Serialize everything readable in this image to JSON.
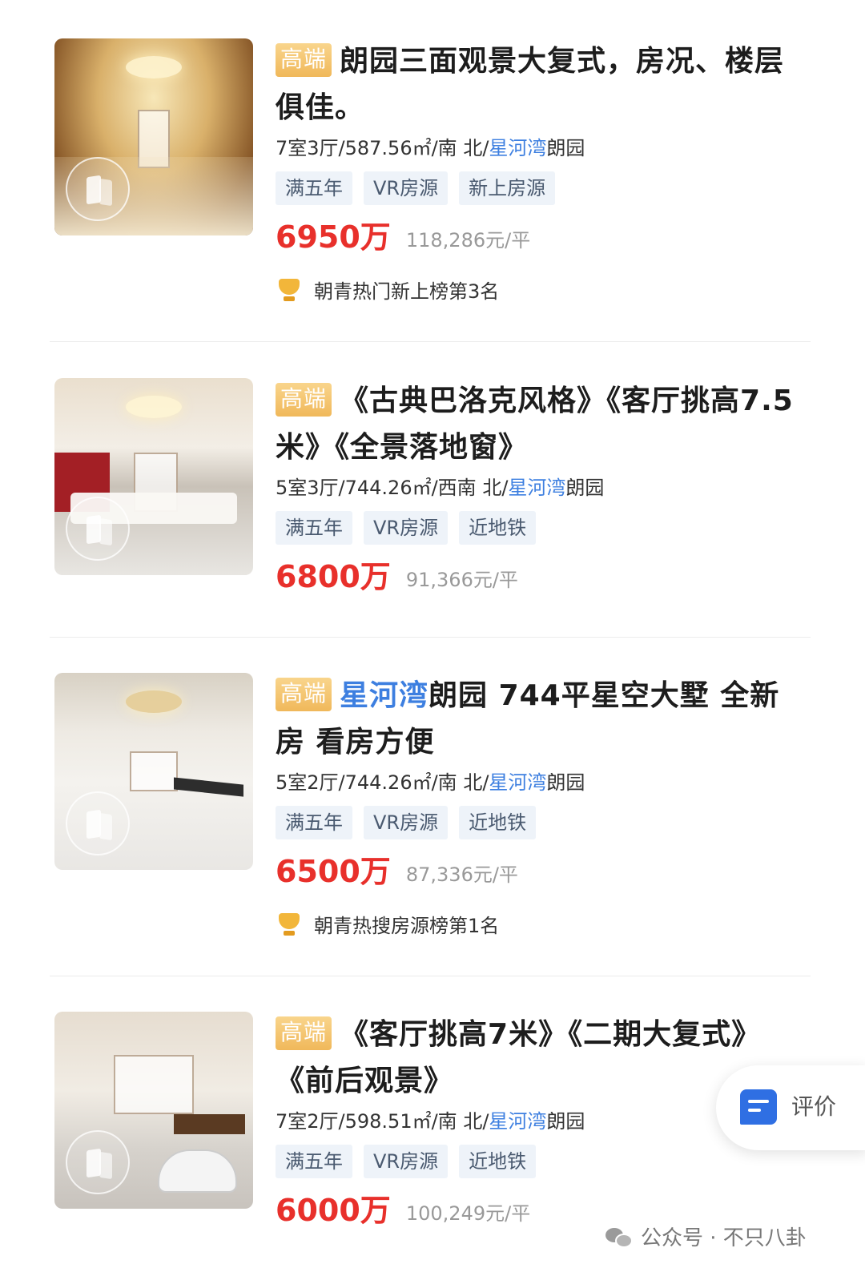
{
  "listings": [
    {
      "badge": "高端",
      "title_pre": "",
      "title_hl": "",
      "title_post": "朗园三面观景大复式，房况、楼层俱佳。",
      "meta_pre": "7室3厅/587.56㎡/南 北/",
      "meta_hl": "星河湾",
      "meta_post": "朗园",
      "tags": [
        "满五年",
        "VR房源",
        "新上房源"
      ],
      "price": "6950万",
      "unit_price": "118,286元/平",
      "rank": "朝青热门新上榜第3名"
    },
    {
      "badge": "高端",
      "title_pre": "",
      "title_hl": "",
      "title_post": "《古典巴洛克风格》《客厅挑高7.5米》《全景落地窗》",
      "meta_pre": "5室3厅/744.26㎡/西南 北/",
      "meta_hl": "星河湾",
      "meta_post": "朗园",
      "tags": [
        "满五年",
        "VR房源",
        "近地铁"
      ],
      "price": "6800万",
      "unit_price": "91,366元/平",
      "rank": ""
    },
    {
      "badge": "高端",
      "title_pre": "",
      "title_hl": "星河湾",
      "title_post": "朗园 744平星空大墅 全新房 看房方便",
      "meta_pre": "5室2厅/744.26㎡/南 北/",
      "meta_hl": "星河湾",
      "meta_post": "朗园",
      "tags": [
        "满五年",
        "VR房源",
        "近地铁"
      ],
      "price": "6500万",
      "unit_price": "87,336元/平",
      "rank": "朝青热搜房源榜第1名"
    },
    {
      "badge": "高端",
      "title_pre": "",
      "title_hl": "",
      "title_post": "《客厅挑高7米》《二期大复式》《前后观景》",
      "meta_pre": "7室2厅/598.51㎡/南 北/",
      "meta_hl": "星河湾",
      "meta_post": "朗园",
      "tags": [
        "满五年",
        "VR房源",
        "近地铁"
      ],
      "price": "6000万",
      "unit_price": "100,249元/平",
      "rank": ""
    }
  ],
  "floating_button": {
    "label": "评价",
    "icon": "review-chat-icon"
  },
  "watermark": {
    "text": "公众号 · 不只八卦",
    "icon": "wechat-icon"
  },
  "colors": {
    "price": "#e8302b",
    "highlight": "#3d7fe0",
    "badge": "#f0b85a",
    "tag_bg": "#eef3f9"
  }
}
